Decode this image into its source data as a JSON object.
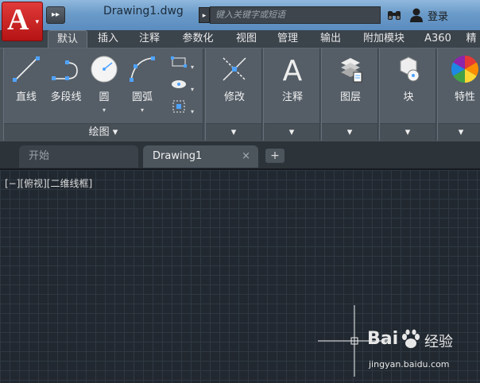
{
  "titlebar": {
    "app_logo_text": "A",
    "qat_more": "▸▸",
    "doc_title": "Drawing1.dwg",
    "search_placeholder": "键入关键字或短语",
    "login_label": "登录"
  },
  "ribbon_tabs": [
    "默认",
    "插入",
    "注释",
    "参数化",
    "视图",
    "管理",
    "输出",
    "附加模块",
    "A360",
    "精"
  ],
  "active_tab": "默认",
  "draw_panel": {
    "tools": [
      {
        "label": "直线",
        "icon": "line-icon"
      },
      {
        "label": "多段线",
        "icon": "polyline-icon"
      },
      {
        "label": "圆",
        "icon": "circle-icon"
      },
      {
        "label": "圆弧",
        "icon": "arc-icon"
      }
    ],
    "footer": "绘图 ▾"
  },
  "panels": [
    {
      "label": "修改",
      "icon": "modify-icon"
    },
    {
      "label": "注释",
      "icon": "annotation-icon"
    },
    {
      "label": "图层",
      "icon": "layers-icon"
    },
    {
      "label": "块",
      "icon": "block-icon"
    },
    {
      "label": "特性",
      "icon": "properties-icon"
    }
  ],
  "doc_tabs": {
    "start": "开始",
    "current": "Drawing1",
    "close": "×",
    "add": "+"
  },
  "canvas": {
    "viewport_label": "[−][俯视][二维线框]"
  },
  "watermark": {
    "brand": "Bai",
    "brand2": "经验",
    "url": "jingyan.baidu.com"
  },
  "colors": {
    "titlebar": "#6b9bc9",
    "canvas": "#212830",
    "app_button": "#c41e1e",
    "ribbon": "#555e67"
  }
}
